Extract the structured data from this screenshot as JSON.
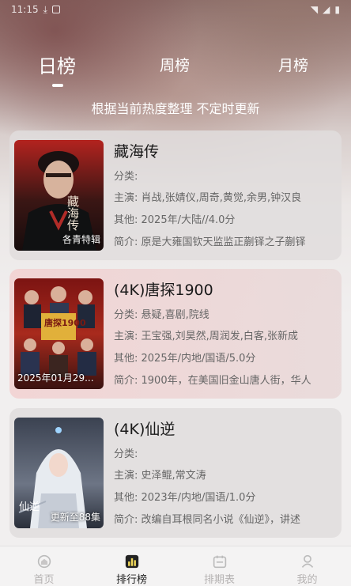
{
  "status_bar": {
    "time": "11:15"
  },
  "tabs": [
    {
      "label": "日榜",
      "active": true
    },
    {
      "label": "周榜",
      "active": false
    },
    {
      "label": "月榜",
      "active": false
    }
  ],
  "subtitle": "根据当前热度整理 不定时更新",
  "items": [
    {
      "title": "藏海传",
      "category": "分类:",
      "cast": "主演: 肖战,张婧仪,周奇,黄觉,余男,钟汉良",
      "other": "其他: 2025年/大陆//4.0分",
      "intro": "简介: 原是大雍国钦天监监正蒯铎之子蒯铎",
      "poster_tag": "各青特辑",
      "poster_text": "藏海传"
    },
    {
      "title": "(4K)唐探1900",
      "category": "分类: 悬疑,喜剧,院线",
      "cast": "主演: 王宝强,刘昊然,周润发,白客,张新成",
      "other": "其他: 2025年/内地/国语/5.0分",
      "intro": "简介: 1900年，在美国旧金山唐人街，华人",
      "poster_tag": "2025年01月29...",
      "poster_text": "唐探1900"
    },
    {
      "title": "(4K)仙逆",
      "category": "分类:",
      "cast": "主演: 史泽鲲,常文涛",
      "other": "其他: 2023年/内地/国语/1.0分",
      "intro": "简介: 改编自耳根同名小说《仙逆》，讲述",
      "poster_tag": "更新至88集",
      "poster_text": "仙逆"
    }
  ],
  "nav": [
    {
      "label": "首页",
      "icon": "home-icon"
    },
    {
      "label": "排行榜",
      "icon": "chart-icon",
      "active": true
    },
    {
      "label": "排期表",
      "icon": "calendar-icon"
    },
    {
      "label": "我的",
      "icon": "user-icon"
    }
  ]
}
